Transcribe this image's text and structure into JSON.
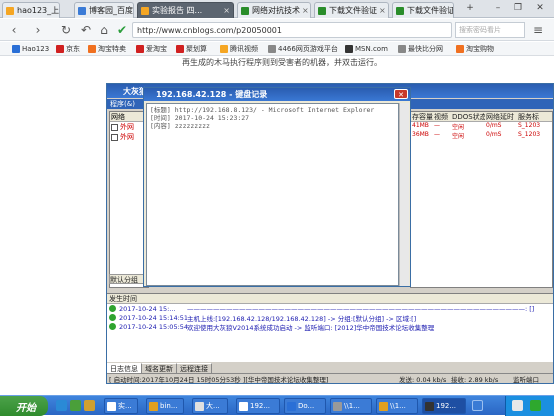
{
  "browser": {
    "tabs": [
      {
        "label": "hao123_上...",
        "fav": "#f5a623"
      },
      {
        "label": "博客园_百度...",
        "fav": "#3b7bd6"
      },
      {
        "label": "实验报告 四...",
        "fav": "#f5a623"
      },
      {
        "label": "网络对抗技术",
        "fav": "#2a8d2a"
      },
      {
        "label": "下载文件验证",
        "fav": "#2a8d2a"
      },
      {
        "label": "下载文件验证",
        "fav": "#2a8d2a"
      }
    ],
    "url": "http://www.cnblogs.com/p20050001",
    "search_placeholder": "搜索密码看片",
    "bookmarks": [
      {
        "label": "Hao123",
        "color": "#2a6fd6"
      },
      {
        "label": "京东",
        "color": "#d02020"
      },
      {
        "label": "淘宝特卖",
        "color": "#f07020"
      },
      {
        "label": "爱淘宝",
        "color": "#d02020"
      },
      {
        "label": "聚划算",
        "color": "#d02020"
      },
      {
        "label": "腾讯视频",
        "color": "#f5a623"
      },
      {
        "label": "4466网页游戏平台",
        "color": "#888888"
      },
      {
        "label": "MSN.com",
        "color": "#333333"
      },
      {
        "label": "最快比分网",
        "color": "#888888"
      },
      {
        "label": "淘宝购物",
        "color": "#f07020"
      }
    ],
    "page_text": "再生成的木马执行程序则到受害者的机器，并双击运行。"
  },
  "dahui": {
    "title": "大灰狼",
    "menu": "程序(&)",
    "group_header": "网络",
    "groups": [
      "外网",
      "外网"
    ],
    "sub_tab": "默认分组",
    "columns": [
      "存容量",
      "视频",
      "DDOS状态",
      "网络延时",
      "服务标"
    ],
    "rows": [
      [
        "41MB",
        "—",
        "空闲",
        "0/mS",
        "S_1203"
      ],
      [
        "36MB",
        "—",
        "空闲",
        "0/mS",
        "S_1203"
      ]
    ],
    "log_header": "发生时间",
    "logs": [
      {
        "time": "2017-10-24 15:...",
        "msg": "————————————————————————————————————————————————————: []"
      },
      {
        "time": "2017-10-24 15:14:51",
        "msg": "主机上线:[192.168.42.128/192.168.42.128] -> 分组:[默认分组] -> 区域:[]"
      },
      {
        "time": "2017-10-24 15:05:54",
        "msg": "欢迎使用大灰狼V2014系统成功启动 -> 监听端口: [2012]华中帝国技术论坛收集整理"
      }
    ],
    "tabs": [
      "日志信息",
      "域名更新",
      "远程连接"
    ],
    "status": {
      "started": "[ 启动时间:2017年10月24日 15时05分53秒 ][华中帝国技术论坛收集整理]",
      "send": "发送: 0.04 kb/s",
      "recv": "接收: 2.89 kb/s",
      "port": "监听端口"
    }
  },
  "keylog": {
    "title": "192.168.42.128 - 键盘记录",
    "lines": [
      "[标题] http://192.168.8.123/ - Microsoft Internet Explorer",
      "[时间] 2017-10-24  15:23:27",
      "[内容] zzzzzzzzz"
    ]
  },
  "taskbar": {
    "start": "开始",
    "items": [
      {
        "label": "实...",
        "color": "#ffffff"
      },
      {
        "label": "bin...",
        "color": "#e0a020"
      },
      {
        "label": "大...",
        "color": "#e0e0e0"
      },
      {
        "label": "192...",
        "color": "#ffffff"
      },
      {
        "label": "Do...",
        "color": "#2a6fd6"
      },
      {
        "label": "\\\\1...",
        "color": "#999999"
      },
      {
        "label": "\\\\1...",
        "color": "#e0a020"
      },
      {
        "label": "192...",
        "color": "#333333"
      }
    ]
  }
}
